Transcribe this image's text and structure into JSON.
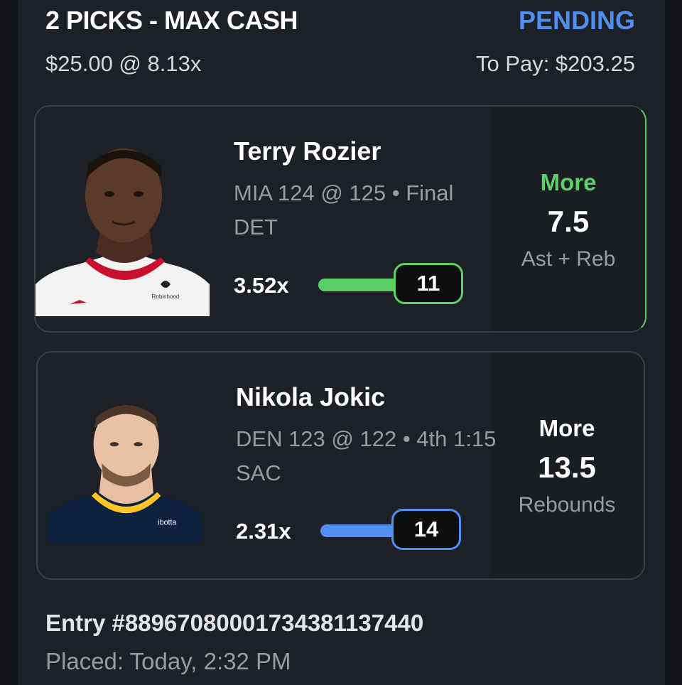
{
  "header": {
    "title": "2 PICKS - MAX CASH",
    "status": "PENDING",
    "stake": "$25.00 @ 8.13x",
    "to_pay": "To Pay: $203.25"
  },
  "picks": [
    {
      "player": "Terry Rozier",
      "matchup_line1": "MIA 124 @ 125  • Final",
      "matchup_line2": "DET",
      "multiplier": "3.52x",
      "current": "11",
      "direction": "More",
      "line": "7.5",
      "stat": "Ast + Reb",
      "accent": "#5ad067",
      "jersey_text": "Robinhood"
    },
    {
      "player": "Nikola Jokic",
      "matchup_line1": "DEN 123 @ 122  • 4th 1:15",
      "matchup_line2": "SAC",
      "multiplier": "2.31x",
      "current": "14",
      "direction": "More",
      "line": "13.5",
      "stat": "Rebounds",
      "accent": "#4f8ff0",
      "jersey_text": "ibotta"
    }
  ],
  "footer": {
    "entry": "Entry #889670800017343811374​40",
    "placed": "Placed: Today, 2:32 PM"
  },
  "colors": {
    "background": "#1d2026",
    "pending": "#4f8ff0",
    "more": "#5ad067"
  }
}
